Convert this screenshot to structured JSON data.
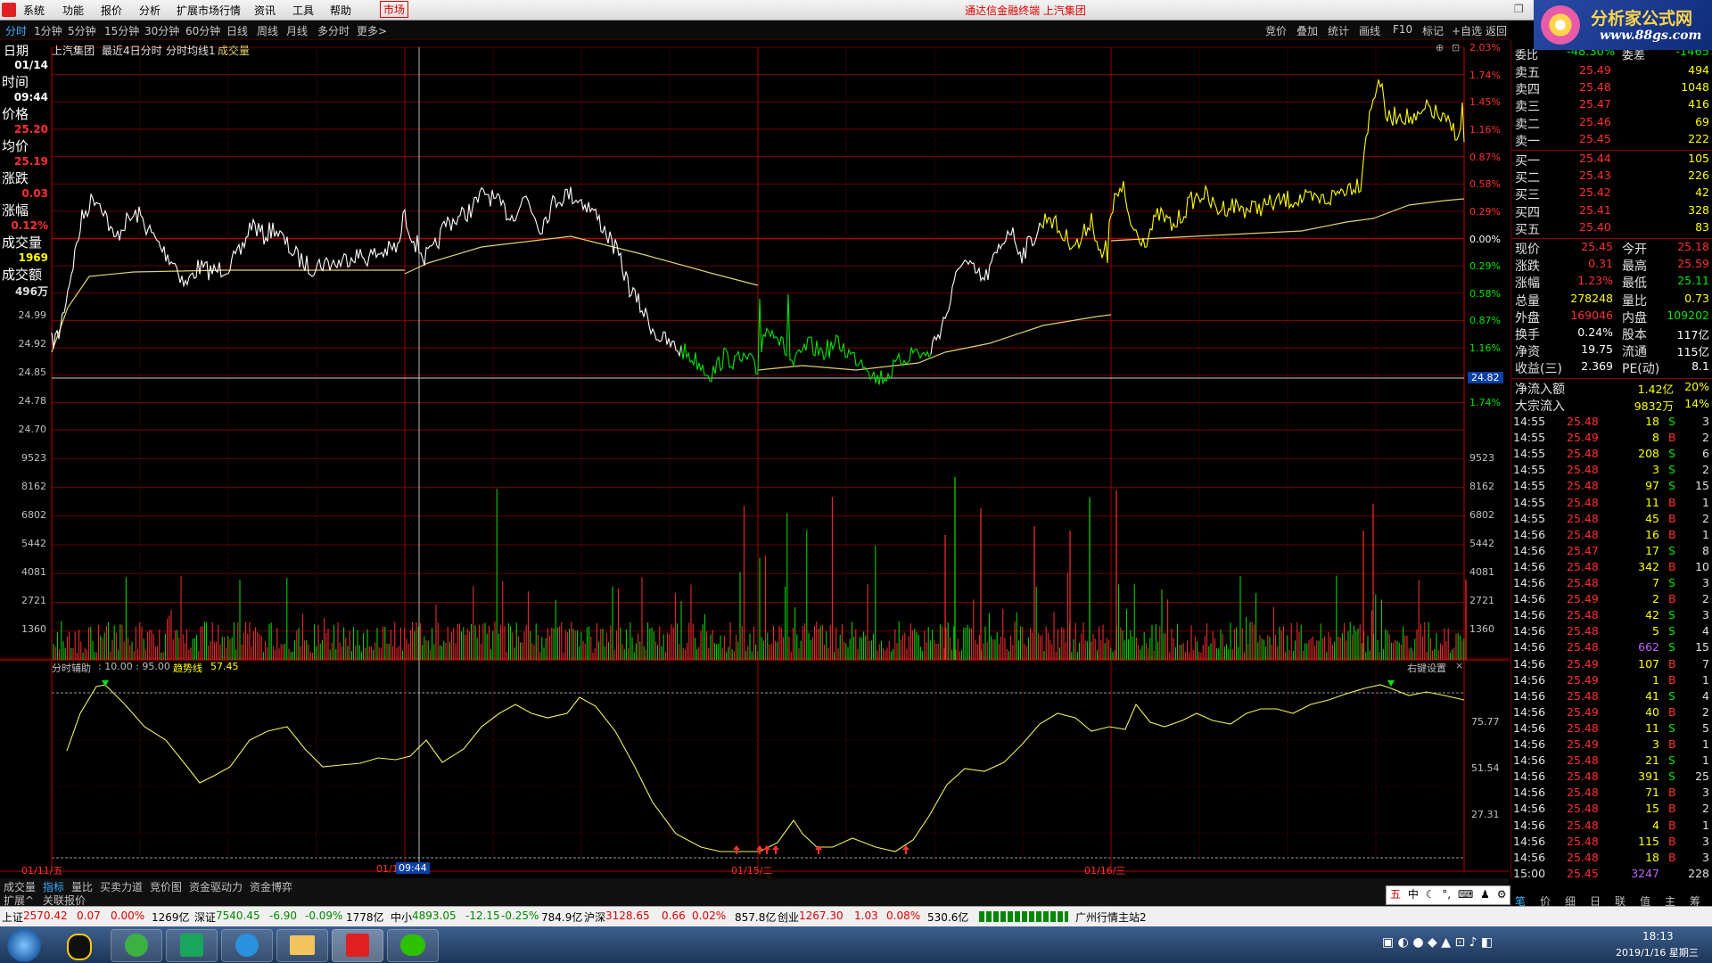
{
  "menubar": {
    "items": [
      "系统",
      "功能",
      "报价",
      "分析",
      "扩展市场行情",
      "资讯",
      "工具",
      "帮助"
    ],
    "market": "市场",
    "app_title": "通达信金融终端 上汽集团"
  },
  "brand": {
    "line1": "分析家公式网",
    "line2": "www.88gs.com"
  },
  "toolbar": {
    "periods": [
      "分时",
      "1分钟",
      "5分钟",
      "15分钟",
      "30分钟",
      "60分钟",
      "日线",
      "周线",
      "月线",
      "多分时",
      "更多>"
    ],
    "right": [
      "竞价",
      "叠加",
      "统计",
      "画线",
      "F10",
      "标记",
      "+自选",
      "返回"
    ]
  },
  "header": {
    "date_label": "日期",
    "stock": "上汽集团",
    "mode": "最近4日分时",
    "avg_line": "分时均线1",
    "volume": "成交量"
  },
  "cursor_info": {
    "date_value": "01/14",
    "time_label": "时间",
    "time_value": "09:44",
    "price_label": "价格",
    "price_value": "25.20",
    "avg_label": "均价",
    "avg_value": "25.19",
    "change_label": "涨跌",
    "change_value": "0.03",
    "pct_label": "涨幅",
    "pct_value": "0.12%",
    "vol_label": "成交量",
    "vol_value": "1969",
    "amount_label": "成交额",
    "amount_value": "496万"
  },
  "price_axis": {
    "left_lower": [
      "24.99",
      "24.92",
      "24.85",
      "24.78",
      "24.70"
    ],
    "right_pct": [
      "2.03%",
      "1.74%",
      "1.45%",
      "1.16%",
      "0.87%",
      "0.58%",
      "0.29%",
      "0.00%",
      "0.29%",
      "0.58%",
      "0.87%",
      "1.16%",
      "1.45%",
      "1.74%"
    ],
    "right_pct_colors": [
      "red",
      "red",
      "red",
      "red",
      "red",
      "red",
      "red",
      "white",
      "green",
      "green",
      "green",
      "green",
      "green",
      "green"
    ],
    "current_marker": "24.82"
  },
  "volume_axis": {
    "left": [
      "9523",
      "8162",
      "6802",
      "5442",
      "4081",
      "2721",
      "1360"
    ],
    "right": [
      "9523",
      "8162",
      "6802",
      "5442",
      "4081",
      "2721",
      "1360"
    ]
  },
  "indicator": {
    "title": "分时辅助",
    "params": ": 10.00 : 95.00",
    "trend_label": "趋势线",
    "trend_value": "57.45",
    "settings": "右键设置",
    "axis": [
      "75.77",
      "51.54",
      "27.31"
    ]
  },
  "x_dates": [
    "01/11/五",
    "01/1",
    "09:44",
    "01/15/二",
    "01/16/三"
  ],
  "bottom_tabs": [
    "成交量",
    "指标",
    "量比",
    "买卖力道",
    "竞价图",
    "资金驱动力",
    "资金博弈"
  ],
  "bottom_tabs2": [
    "扩展^",
    "关联报价"
  ],
  "orderbook": {
    "weibi_label": "委比",
    "weibi_value": "-48.30%",
    "weicha_label": "委差",
    "weicha_value": "-1465",
    "asks": [
      {
        "label": "卖五",
        "price": "25.49",
        "vol": "494"
      },
      {
        "label": "卖四",
        "price": "25.48",
        "vol": "1048"
      },
      {
        "label": "卖三",
        "price": "25.47",
        "vol": "416"
      },
      {
        "label": "卖二",
        "price": "25.46",
        "vol": "69"
      },
      {
        "label": "卖一",
        "price": "25.45",
        "vol": "222"
      }
    ],
    "bids": [
      {
        "label": "买一",
        "price": "25.44",
        "vol": "105"
      },
      {
        "label": "买二",
        "price": "25.43",
        "vol": "226"
      },
      {
        "label": "买三",
        "price": "25.42",
        "vol": "42"
      },
      {
        "label": "买四",
        "price": "25.41",
        "vol": "328"
      },
      {
        "label": "买五",
        "price": "25.40",
        "vol": "83"
      }
    ]
  },
  "quote": [
    {
      "l1": "现价",
      "v1": "25.45",
      "l2": "今开",
      "v2": "25.18",
      "c1": "red",
      "c2": "red"
    },
    {
      "l1": "涨跌",
      "v1": "0.31",
      "l2": "最高",
      "v2": "25.59",
      "c1": "red",
      "c2": "red"
    },
    {
      "l1": "涨幅",
      "v1": "1.23%",
      "l2": "最低",
      "v2": "25.11",
      "c1": "red",
      "c2": "green"
    },
    {
      "l1": "总量",
      "v1": "278248",
      "l2": "量比",
      "v2": "0.73",
      "c1": "yellow",
      "c2": "yellow"
    },
    {
      "l1": "外盘",
      "v1": "169046",
      "l2": "内盘",
      "v2": "109202",
      "c1": "red",
      "c2": "green"
    },
    {
      "l1": "换手",
      "v1": "0.24%",
      "l2": "股本",
      "v2": "117亿",
      "c1": "white",
      "c2": "white"
    },
    {
      "l1": "净资",
      "v1": "19.75",
      "l2": "流通",
      "v2": "115亿",
      "c1": "white",
      "c2": "white"
    },
    {
      "l1": "收益(三)",
      "v1": "2.369",
      "l2": "PE(动)",
      "v2": "8.1",
      "c1": "white",
      "c2": "white"
    }
  ],
  "flows": [
    {
      "label": "净流入额",
      "value": "1.42亿",
      "pct": "20%"
    },
    {
      "label": "大宗流入",
      "value": "9832万",
      "pct": "14%"
    }
  ],
  "ticks": [
    [
      "14:55",
      "25.48",
      "18",
      "S",
      "3"
    ],
    [
      "14:55",
      "25.49",
      "8",
      "B",
      "2"
    ],
    [
      "14:55",
      "25.48",
      "208",
      "S",
      "6"
    ],
    [
      "14:55",
      "25.48",
      "3",
      "S",
      "2"
    ],
    [
      "14:55",
      "25.48",
      "97",
      "S",
      "15"
    ],
    [
      "14:55",
      "25.48",
      "11",
      "B",
      "1"
    ],
    [
      "14:55",
      "25.48",
      "45",
      "B",
      "2"
    ],
    [
      "14:56",
      "25.48",
      "16",
      "B",
      "1"
    ],
    [
      "14:56",
      "25.47",
      "17",
      "S",
      "8"
    ],
    [
      "14:56",
      "25.48",
      "342",
      "B",
      "10"
    ],
    [
      "14:56",
      "25.48",
      "7",
      "S",
      "3"
    ],
    [
      "14:56",
      "25.49",
      "2",
      "B",
      "2"
    ],
    [
      "14:56",
      "25.48",
      "42",
      "S",
      "3"
    ],
    [
      "14:56",
      "25.48",
      "5",
      "S",
      "4"
    ],
    [
      "14:56",
      "25.48",
      "662",
      "S",
      "15"
    ],
    [
      "14:56",
      "25.49",
      "107",
      "B",
      "7"
    ],
    [
      "14:56",
      "25.49",
      "1",
      "B",
      "1"
    ],
    [
      "14:56",
      "25.48",
      "41",
      "S",
      "4"
    ],
    [
      "14:56",
      "25.49",
      "40",
      "B",
      "2"
    ],
    [
      "14:56",
      "25.48",
      "11",
      "S",
      "5"
    ],
    [
      "14:56",
      "25.49",
      "3",
      "B",
      "1"
    ],
    [
      "14:56",
      "25.48",
      "21",
      "S",
      "1"
    ],
    [
      "14:56",
      "25.48",
      "391",
      "S",
      "25"
    ],
    [
      "14:56",
      "25.48",
      "71",
      "B",
      "3"
    ],
    [
      "14:56",
      "25.48",
      "15",
      "B",
      "2"
    ],
    [
      "14:56",
      "25.48",
      "4",
      "B",
      "1"
    ],
    [
      "14:56",
      "25.48",
      "115",
      "B",
      "3"
    ],
    [
      "14:56",
      "25.48",
      "18",
      "B",
      "3"
    ],
    [
      "15:00",
      "25.45",
      "3247",
      "",
      ""
    ]
  ],
  "tick_last_extra": "228",
  "right_tabs": [
    "笔",
    "价",
    "细",
    "日",
    "联",
    "值",
    "主",
    "筹"
  ],
  "status": {
    "sh_label": "上证",
    "sh": "2570.42",
    "sh_chg": "0.07",
    "sh_pct": "0.00%",
    "sh_amt": "1269亿",
    "sz_label": "深证",
    "sz": "7540.45",
    "sz_chg": "-6.90",
    "sz_pct": "-0.09%",
    "sz_amt": "1778亿",
    "zx_label": "中小",
    "zx": "4893.05",
    "zx_chg": "-12.15",
    "zx_pct": "-0.25%",
    "zx_amt": "784.9亿",
    "hs_label": "沪深",
    "hs": "3128.65",
    "hs_chg": "0.66",
    "hs_pct": "0.02%",
    "hs_amt": "857.8亿",
    "cy_label": "创业",
    "cy": "1267.30",
    "cy_chg": "1.03",
    "cy_pct": "0.08%",
    "cy_amt": "530.6亿",
    "server": "广州行情主站2"
  },
  "ime": [
    "五",
    "中",
    "☾",
    "°,",
    "⌨",
    "♟",
    "⚙"
  ],
  "clock": {
    "time": "18:13",
    "date": "2019/1/16 星期三"
  },
  "colors": {
    "red": "#ff3030",
    "green": "#00e600",
    "yellow": "#ffff00",
    "grid": "#8b0000",
    "price_line": "#ffffff",
    "avg_line": "#e0d070"
  }
}
